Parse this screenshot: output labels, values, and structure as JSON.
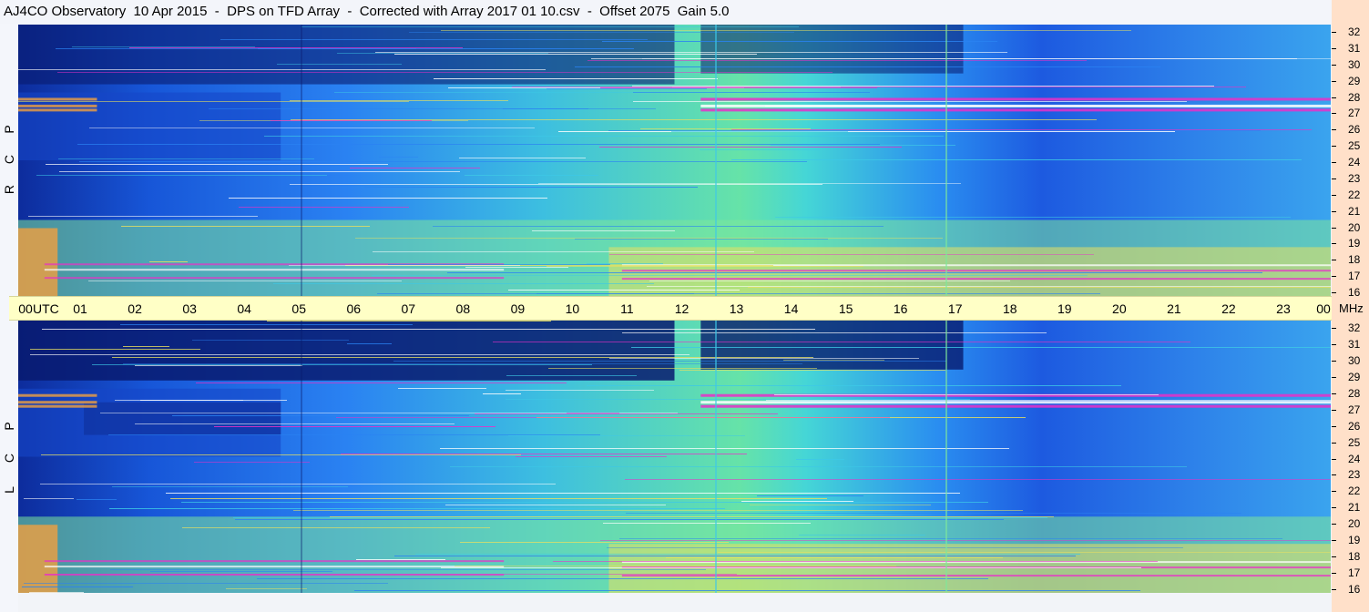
{
  "title": "AJ4CO Observatory  10 Apr 2015  -  DPS on TFD Array  -  Corrected with Array 2017 01 10.csv  -  Offset 2075  Gain 5.0",
  "time_axis": {
    "labels": [
      "00",
      "01",
      "02",
      "03",
      "04",
      "05",
      "06",
      "07",
      "08",
      "09",
      "10",
      "11",
      "12",
      "13",
      "14",
      "15",
      "16",
      "17",
      "18",
      "19",
      "20",
      "21",
      "22",
      "23",
      "00"
    ],
    "unit": "UTC"
  },
  "freq_axis": {
    "labels": [
      "32",
      "31",
      "30",
      "29",
      "28",
      "27",
      "26",
      "25",
      "24",
      "23",
      "22",
      "21",
      "20",
      "19",
      "18",
      "17",
      "16"
    ],
    "unit": "MHz"
  },
  "panels": [
    {
      "id": "rcp",
      "letters": [
        "R",
        "C",
        "P"
      ]
    },
    {
      "id": "lcp",
      "letters": [
        "L",
        "C",
        "P"
      ]
    }
  ],
  "colors": {
    "dark": "#081a6e",
    "deep_blue": "#1546c8",
    "blue": "#2a82f2",
    "cyan": "#3dc8e6",
    "green": "#7ee89a",
    "yellow": "#e8e060",
    "orange": "#f0a040",
    "magenta": "#e830c8",
    "white": "#ffffff",
    "axis_bg": "#ffffc6",
    "right_strip": "#ffe0c9"
  },
  "chart_data": [
    {
      "type": "heatmap",
      "title": "AJ4CO Observatory  10 Apr 2015  -  DPS on TFD Array  -  Corrected with Array 2017 01 10.csv  -  Offset 2075  Gain 5.0",
      "xlabel": "UTC",
      "ylabel": "R C P",
      "x_range": [
        "00",
        "00"
      ],
      "y_range_mhz": [
        16,
        32
      ],
      "series_name": "RCP"
    },
    {
      "type": "heatmap",
      "xlabel": "UTC",
      "ylabel": "L C P",
      "x_range": [
        "00",
        "00"
      ],
      "y_range_mhz": [
        16,
        32
      ],
      "series_name": "LCP"
    }
  ]
}
